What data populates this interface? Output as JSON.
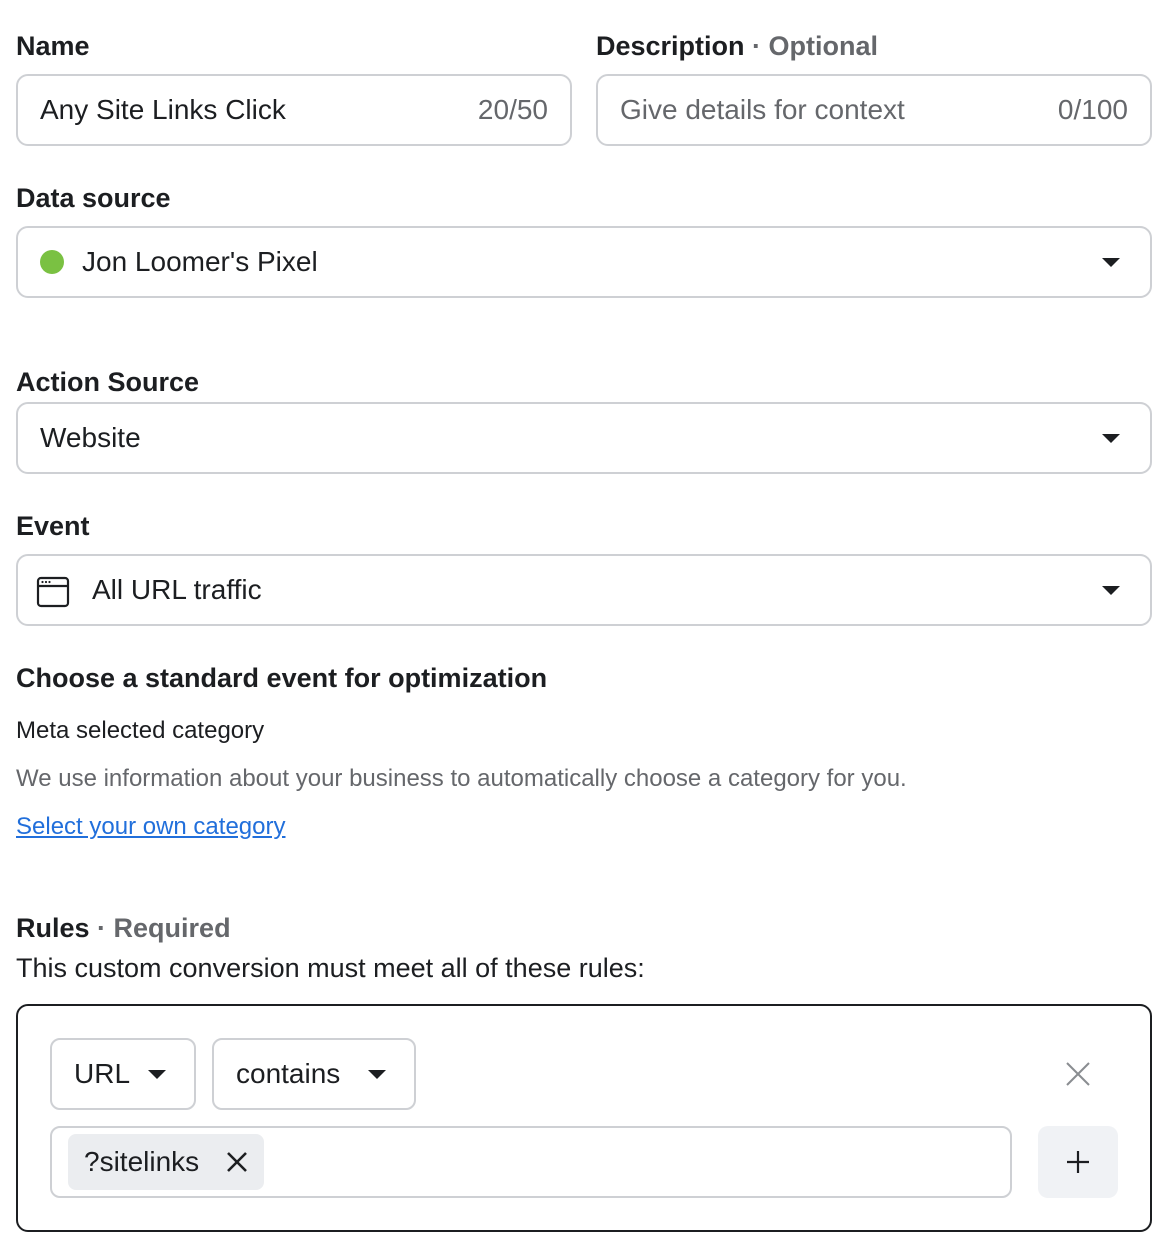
{
  "name": {
    "label": "Name",
    "value": "Any Site Links Click",
    "counter": "20/50"
  },
  "description": {
    "label": "Description",
    "optional": "· Optional",
    "placeholder": "Give details for context",
    "counter": "0/100"
  },
  "data_source": {
    "label": "Data source",
    "value": "Jon Loomer's Pixel",
    "status_color": "#7ac142"
  },
  "action_source": {
    "label": "Action Source",
    "value": "Website"
  },
  "event": {
    "label": "Event",
    "value": "All URL traffic",
    "icon": "browser-window-icon"
  },
  "optimization": {
    "heading": "Choose a standard event for optimization",
    "subheading": "Meta selected category",
    "description": "We use information about your business to automatically choose a category for you.",
    "link": "Select your own category"
  },
  "rules": {
    "label": "Rules",
    "required": "· Required",
    "description": "This custom conversion must meet all of these rules:",
    "rule": {
      "field": "URL",
      "operator": "contains",
      "values": [
        "?sitelinks"
      ]
    }
  },
  "colors": {
    "link": "#216fdb",
    "border": "#ced0d4",
    "muted": "#65676b"
  }
}
